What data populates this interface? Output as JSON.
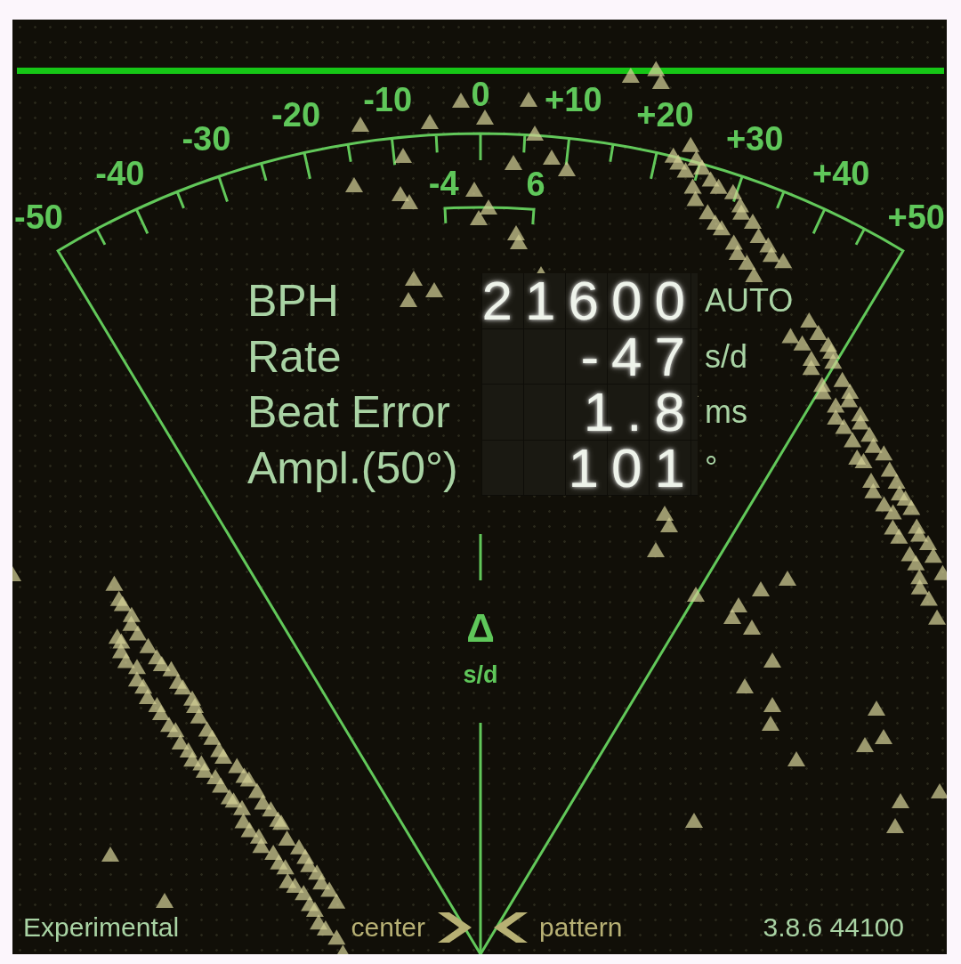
{
  "scale": {
    "labels": [
      "-50",
      "-40",
      "-30",
      "-20",
      "-10",
      "0",
      "+10",
      "+20",
      "+30",
      "+40",
      "+50"
    ],
    "bracket_labels": [
      "-4",
      "6"
    ]
  },
  "readout": {
    "rows": [
      {
        "label": "BPH",
        "value": "21600",
        "unit": "AUTO"
      },
      {
        "label": "Rate",
        "value": "-47",
        "unit": "s/d"
      },
      {
        "label": "Beat Error",
        "value": "1.8",
        "unit": "ms"
      },
      {
        "label": "Ampl.(50°)",
        "value": "101",
        "unit": "°"
      }
    ]
  },
  "delta": {
    "symbol": "Δ",
    "unit": "s/d"
  },
  "footer": {
    "mode": "Experimental",
    "left_label": "center",
    "right_label": "pattern",
    "version": "3.8.6 44100"
  }
}
